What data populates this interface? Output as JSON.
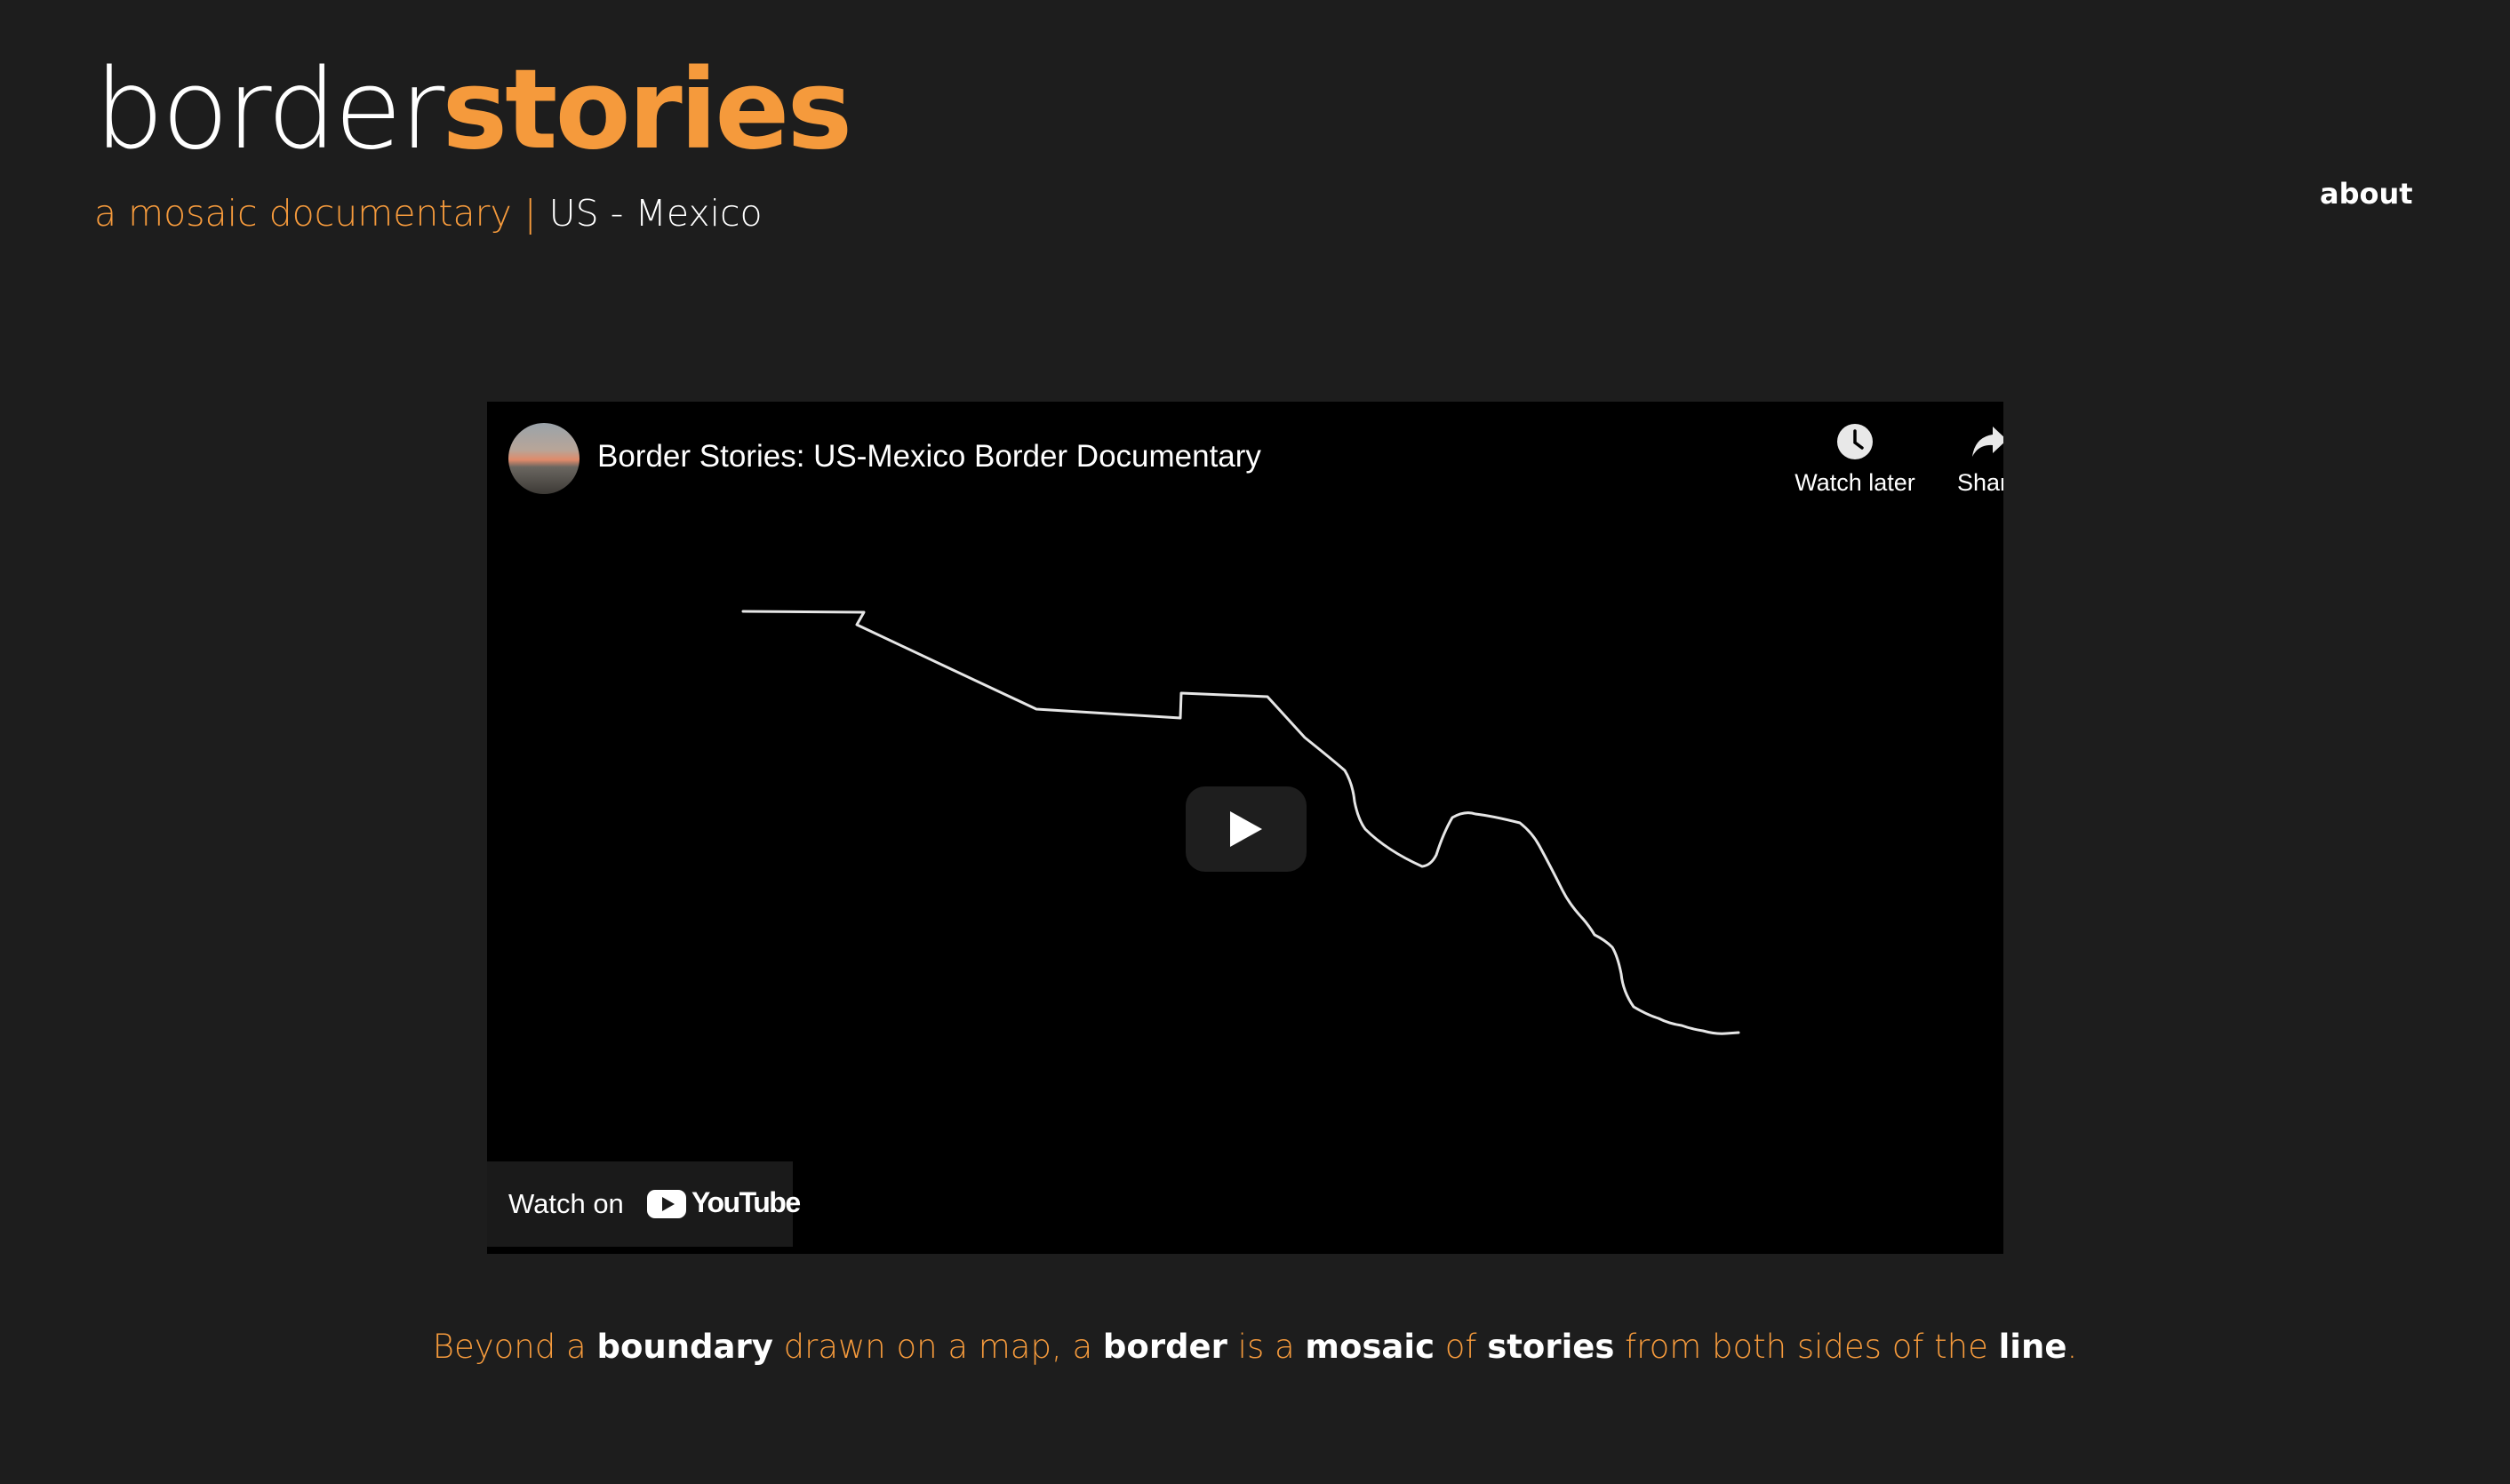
{
  "header": {
    "logo_thin": "border",
    "logo_bold": "stories",
    "tagline_left": "a mosaic documentary",
    "tagline_sep": "|",
    "tagline_right": "US - Mexico"
  },
  "nav": {
    "about_label": "about"
  },
  "video": {
    "title": "Border Stories: US-Mexico Border Documentary",
    "watch_later_label": "Watch later",
    "share_label": "Share",
    "watch_on_label": "Watch on",
    "youtube_word": "YouTube"
  },
  "caption": {
    "p1": "Beyond a ",
    "w1": "boundary",
    "p2": " drawn on a map, a ",
    "w2": "border",
    "p3": " is a ",
    "w3": "mosaic",
    "p4": " of ",
    "w4": "stories",
    "p5": " from both sides of the ",
    "w5": "line",
    "p6": "."
  },
  "colors": {
    "background": "#1d1d1d",
    "accent": "#f59a3c",
    "text": "#ffffff",
    "video_bg": "#000000"
  },
  "icons": [
    "clock-icon",
    "share-arrow-icon",
    "play-icon",
    "youtube-logo-icon"
  ]
}
